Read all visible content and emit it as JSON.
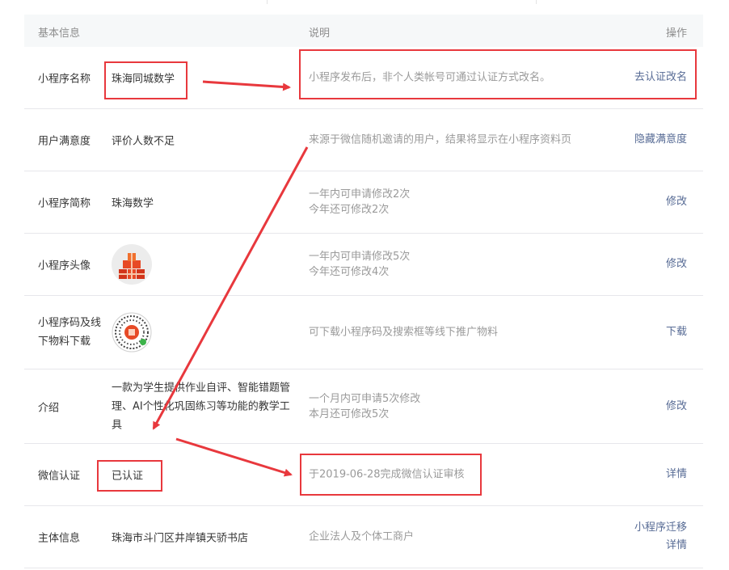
{
  "header": {
    "col_basic": "基本信息",
    "col_desc": "说明",
    "col_op": "操作"
  },
  "rows": [
    {
      "label": "小程序名称",
      "value": "珠海同城数学",
      "desc": "小程序发布后，非个人类帐号可通过认证方式改名。",
      "op": "去认证改名"
    },
    {
      "label": "用户满意度",
      "value": "评价人数不足",
      "desc": "来源于微信随机邀请的用户，结果将显示在小程序资料页",
      "op": "隐藏满意度"
    },
    {
      "label": "小程序简称",
      "value": "珠海数学",
      "desc1": "一年内可申请修改2次",
      "desc2": "今年还可修改2次",
      "op": "修改"
    },
    {
      "label": "小程序头像",
      "desc1": "一年内可申请修改5次",
      "desc2": "今年还可修改4次",
      "op": "修改"
    },
    {
      "label": "小程序码及线下物料下载",
      "desc": "可下载小程序码及搜索框等线下推广物料",
      "op": "下载"
    },
    {
      "label": "介绍",
      "value": "一款为学生提供作业自评、智能错题管理、AI个性化巩固练习等功能的教学工具",
      "desc1": "一个月内可申请5次修改",
      "desc2": "本月还可修改5次",
      "op": "修改"
    },
    {
      "label": "微信认证",
      "value": "已认证",
      "desc": "于2019-06-28完成微信认证审核",
      "op": "详情"
    },
    {
      "label": "主体信息",
      "value": "珠海市斗门区井岸镇天骄书店",
      "desc": "企业法人及个体工商户",
      "op1": "小程序迁移",
      "op2": "详情"
    }
  ],
  "colors": {
    "link": "#576b95",
    "annotation": "#e8383d",
    "muted": "#9a9a9a"
  },
  "icons": {
    "avatar": "gift-boxes-icon",
    "qrcode": "mini-program-code-icon"
  }
}
